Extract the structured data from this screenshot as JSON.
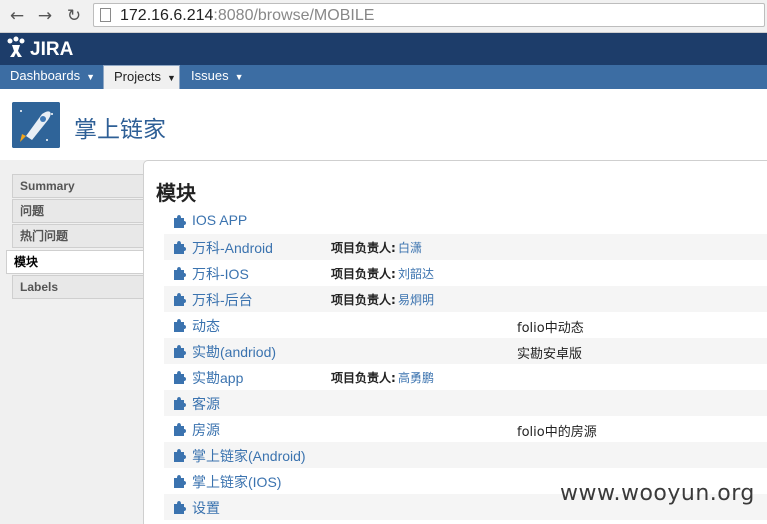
{
  "browser": {
    "back_icon": "arrow-left-icon",
    "forward_icon": "arrow-right-icon",
    "reload_icon": "reload-icon",
    "url_host": "172.16.6.214",
    "url_rest": ":8080/browse/MOBILE"
  },
  "header": {
    "logo_text": "JIRA"
  },
  "menu": [
    {
      "label": "Dashboards"
    },
    {
      "label": "Projects"
    },
    {
      "label": "Issues"
    }
  ],
  "project": {
    "title": "掌上链家"
  },
  "sidebar": [
    {
      "label": "Summary"
    },
    {
      "label": "问题"
    },
    {
      "label": "热门问题"
    },
    {
      "label": "模块"
    },
    {
      "label": "Labels"
    }
  ],
  "main": {
    "title": "模块",
    "lead_label": "项目负责人:",
    "components": [
      {
        "name": "IOS APP",
        "lead": "",
        "description": ""
      },
      {
        "name": "万科-Android",
        "lead": "白潇",
        "description": ""
      },
      {
        "name": "万科-IOS",
        "lead": "刘韶达",
        "description": ""
      },
      {
        "name": "万科-后台",
        "lead": "易炯明",
        "description": ""
      },
      {
        "name": "动态",
        "lead": "",
        "description": "folio中动态"
      },
      {
        "name": "实勘(andriod)",
        "lead": "",
        "description": "实勘安卓版"
      },
      {
        "name": "实勘app",
        "lead": "高勇鹏",
        "description": ""
      },
      {
        "name": "客源",
        "lead": "",
        "description": ""
      },
      {
        "name": "房源",
        "lead": "",
        "description": "folio中的房源"
      },
      {
        "name": "掌上链家(Android)",
        "lead": "",
        "description": ""
      },
      {
        "name": "掌上链家(IOS)",
        "lead": "",
        "description": ""
      },
      {
        "name": "设置",
        "lead": "",
        "description": ""
      }
    ]
  },
  "watermark": "www.wooyun.org",
  "colors": {
    "header": "#1d3d6a",
    "menubar": "#3c6da3",
    "link": "#3b73af"
  }
}
